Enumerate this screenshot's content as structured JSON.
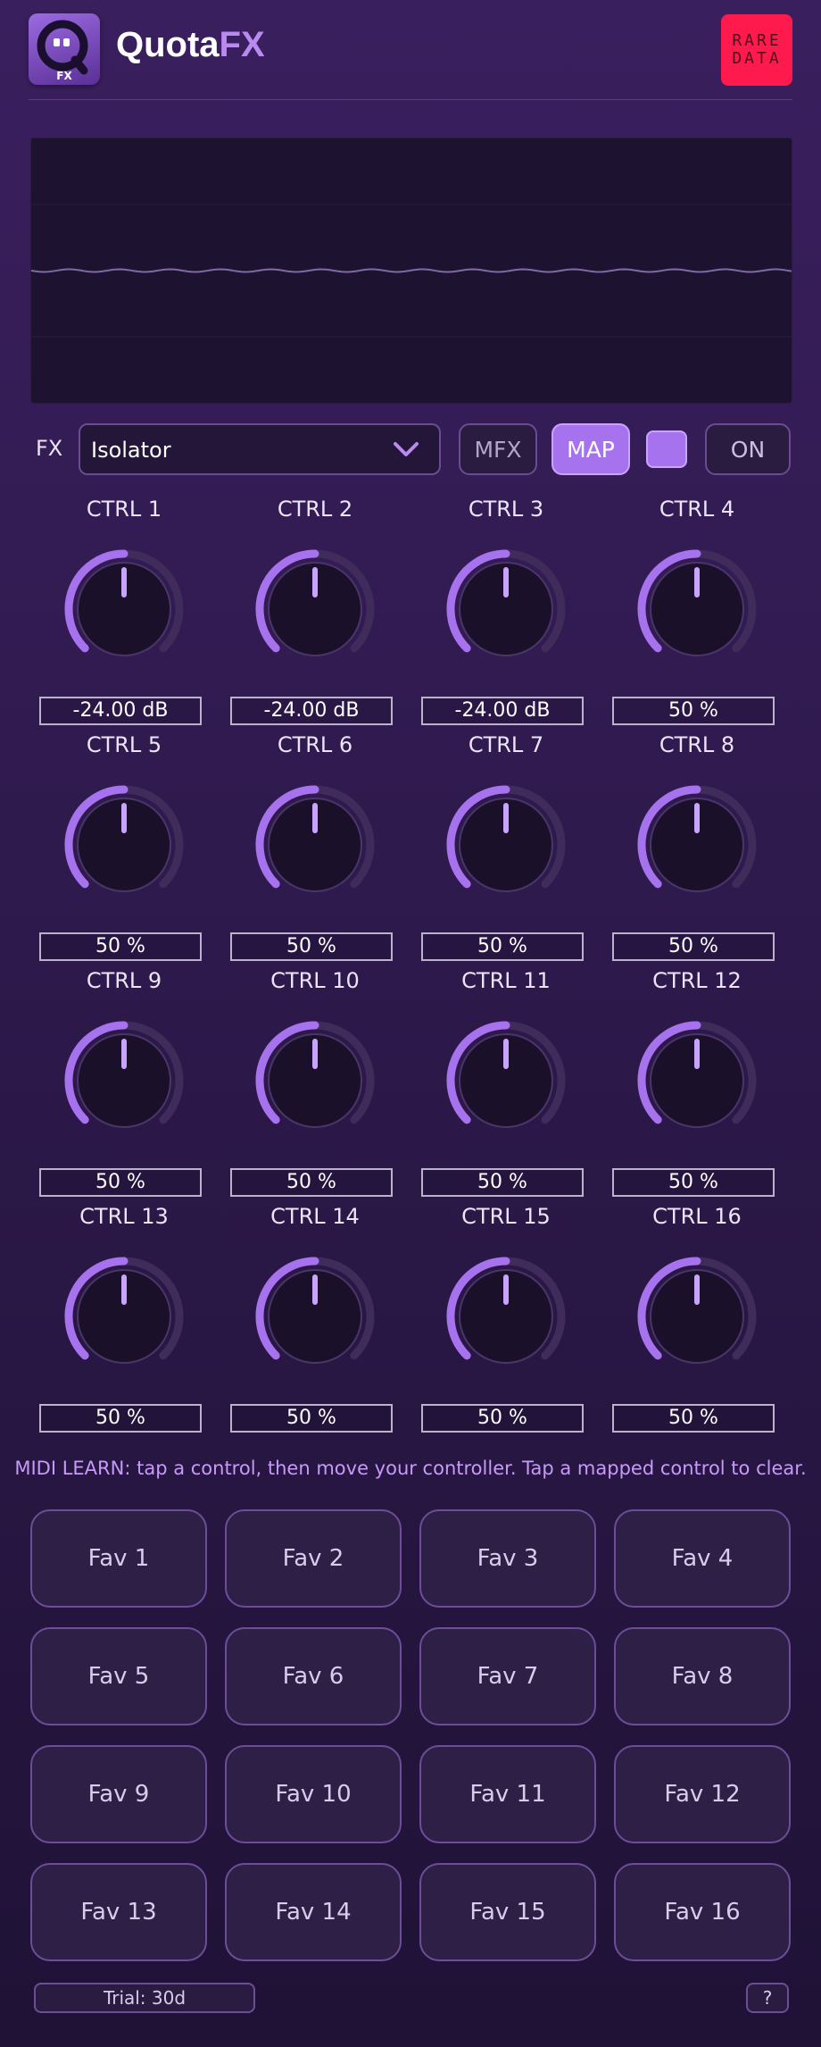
{
  "header": {
    "brand_part1": "Quota",
    "brand_part2": "FX",
    "logo_badge": "FX",
    "rare_line1": "RARE",
    "rare_line2": "DATA"
  },
  "fx": {
    "label": "FX",
    "selected": "Isolator",
    "mfx_label": "MFX",
    "map_label": "MAP",
    "on_label": "ON"
  },
  "controls": [
    {
      "label": "CTRL 1",
      "value": "-24.00 dB"
    },
    {
      "label": "CTRL 2",
      "value": "-24.00 dB"
    },
    {
      "label": "CTRL 3",
      "value": "-24.00 dB"
    },
    {
      "label": "CTRL 4",
      "value": "50 %"
    },
    {
      "label": "CTRL 5",
      "value": "50 %"
    },
    {
      "label": "CTRL 6",
      "value": "50 %"
    },
    {
      "label": "CTRL 7",
      "value": "50 %"
    },
    {
      "label": "CTRL 8",
      "value": "50 %"
    },
    {
      "label": "CTRL 9",
      "value": "50 %"
    },
    {
      "label": "CTRL 10",
      "value": "50 %"
    },
    {
      "label": "CTRL 11",
      "value": "50 %"
    },
    {
      "label": "CTRL 12",
      "value": "50 %"
    },
    {
      "label": "CTRL 13",
      "value": "50 %"
    },
    {
      "label": "CTRL 14",
      "value": "50 %"
    },
    {
      "label": "CTRL 15",
      "value": "50 %"
    },
    {
      "label": "CTRL 16",
      "value": "50 %"
    }
  ],
  "knob_level": 0.5,
  "hint": "MIDI LEARN: tap a control, then move your controller. Tap a mapped control to clear.",
  "favorites": [
    "Fav 1",
    "Fav 2",
    "Fav 3",
    "Fav 4",
    "Fav 5",
    "Fav 6",
    "Fav 7",
    "Fav 8",
    "Fav 9",
    "Fav 10",
    "Fav 11",
    "Fav 12",
    "Fav 13",
    "Fav 14",
    "Fav 15",
    "Fav 16"
  ],
  "footer": {
    "trial": "Trial: 30d",
    "help": "?"
  },
  "colors": {
    "accent": "#a772ee",
    "rare_badge": "#ff1a4d",
    "hint_text": "#c79af7"
  }
}
